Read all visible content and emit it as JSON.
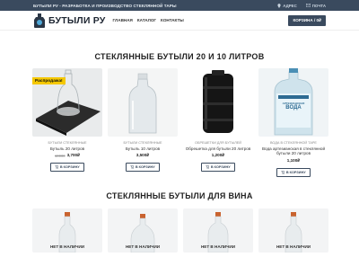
{
  "topbar": {
    "tagline": "БУТЫЛИ РУ - РАЗРАБОТКА И ПРОИЗВОДСТВО СТЕКЛЯННОЙ ТАРЫ",
    "address": "АДРЕС",
    "mail": "ПОЧТА"
  },
  "header": {
    "logo_text": "БУТЫЛИ РУ",
    "nav": [
      "ГЛАВНАЯ",
      "КАТАЛОГ",
      "КОНТАКТЫ"
    ],
    "cart_label": "КОРЗИНА / 0₽"
  },
  "section1": {
    "title": "СТЕКЛЯННЫЕ БУТЫЛИ 20 И 10 ЛИТРОВ"
  },
  "products": [
    {
      "category": "БУТЫЛИ СТЕКЛЯННЫЕ",
      "name": "Бутыль 20 литров",
      "old_price": "10000",
      "price": "3,700₽",
      "button": "В КОРЗИНУ",
      "badge": "Распродажа!"
    },
    {
      "category": "БУТЫЛИ СТЕКЛЯННЫЕ",
      "name": "Бутыль 10 литров",
      "old_price": "",
      "price": "3,500₽",
      "button": "В КОРЗИНУ",
      "badge": ""
    },
    {
      "category": "ОБРЕШЕТКИ ДЛЯ БУТЫЛЕЙ",
      "name": "Обрешетка для бутыли 20 литров",
      "old_price": "",
      "price": "1,200₽",
      "button": "В КОРЗИНУ",
      "badge": ""
    },
    {
      "category": "ВОДА В СТЕКЛЯННОЙ ТАРЕ",
      "name": "Вода артезианская в стеклянной бутыли 20 литров",
      "old_price": "",
      "price": "1,100₽",
      "button": "В КОРЗИНУ",
      "badge": ""
    }
  ],
  "water_label": {
    "line1": "АРТЕЗИАНСКАЯ",
    "line2": "ВОДА"
  },
  "section2": {
    "title": "СТЕКЛЯННЫЕ БУТЫЛИ ДЛЯ ВИНА"
  },
  "wine_items": [
    {
      "status": "НЕТ В НАЛИЧИИ"
    },
    {
      "status": "НЕТ В НАЛИЧИИ"
    },
    {
      "status": "НЕТ В НАЛИЧИИ"
    },
    {
      "status": "НЕТ В НАЛИЧИИ"
    }
  ],
  "colors": {
    "primary": "#3a4a5e",
    "sale": "#f5c800"
  }
}
